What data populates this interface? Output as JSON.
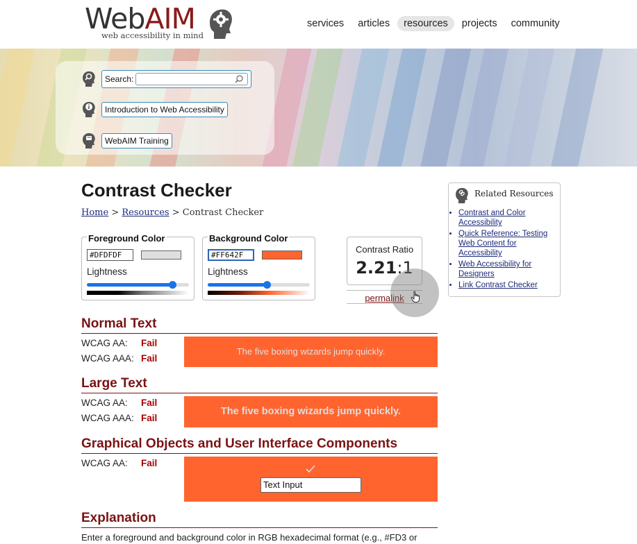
{
  "header": {
    "logo_word_1": "Web",
    "logo_word_2": "AIM",
    "logo_tagline": "web accessibility in mind",
    "nav": [
      {
        "label": "services",
        "active": false
      },
      {
        "label": "articles",
        "active": false
      },
      {
        "label": "resources",
        "active": true
      },
      {
        "label": "projects",
        "active": false
      },
      {
        "label": "community",
        "active": false
      }
    ]
  },
  "banner": {
    "search_label": "Search:",
    "search_value": "",
    "link_intro": "Introduction to Web Accessibility",
    "link_training": "WebAIM Training"
  },
  "page": {
    "title": "Contrast Checker",
    "breadcrumb": {
      "home": "Home",
      "sep1": ">",
      "resources": "Resources",
      "sep2": ">",
      "current": "Contrast Checker"
    }
  },
  "foreground": {
    "label": "Foreground Color",
    "hex": "#DFDFDF",
    "swatch_color": "#DFDFDF",
    "lightness_label": "Lightness",
    "lightness_percent": 87
  },
  "background": {
    "label": "Background Color",
    "hex": "#FF642F",
    "swatch_color": "#FF642F",
    "lightness_label": "Lightness",
    "lightness_percent": 59
  },
  "contrast": {
    "label": "Contrast Ratio",
    "ratio_bold": "2.21",
    "ratio_rest": ":1",
    "permalink": "permalink"
  },
  "normal_text": {
    "heading": "Normal Text",
    "aa_label": "WCAG AA:",
    "aa_result": "Fail",
    "aaa_label": "WCAG AAA:",
    "aaa_result": "Fail",
    "sample": "The five boxing wizards jump quickly."
  },
  "large_text": {
    "heading": "Large Text",
    "aa_label": "WCAG AA:",
    "aa_result": "Fail",
    "aaa_label": "WCAG AAA:",
    "aaa_result": "Fail",
    "sample": "The five boxing wizards jump quickly."
  },
  "graphical": {
    "heading": "Graphical Objects and User Interface Components",
    "aa_label": "WCAG AA:",
    "aa_result": "Fail",
    "input_label": "Text Input"
  },
  "explanation": {
    "heading": "Explanation",
    "text": "Enter a foreground and background color in RGB hexadecimal format (e.g., #FD3 or"
  },
  "related": {
    "title": "Related Resources",
    "links": [
      "Contrast and Color Accessibility",
      "Quick Reference: Testing Web Content for Accessibility",
      "Web Accessibility for Designers",
      "Link Contrast Checker"
    ]
  },
  "colors": {
    "accent_red": "#7a1212",
    "fail_red": "#a80000",
    "link_blue": "#1c2a78",
    "slider_blue": "#1a73e8"
  }
}
